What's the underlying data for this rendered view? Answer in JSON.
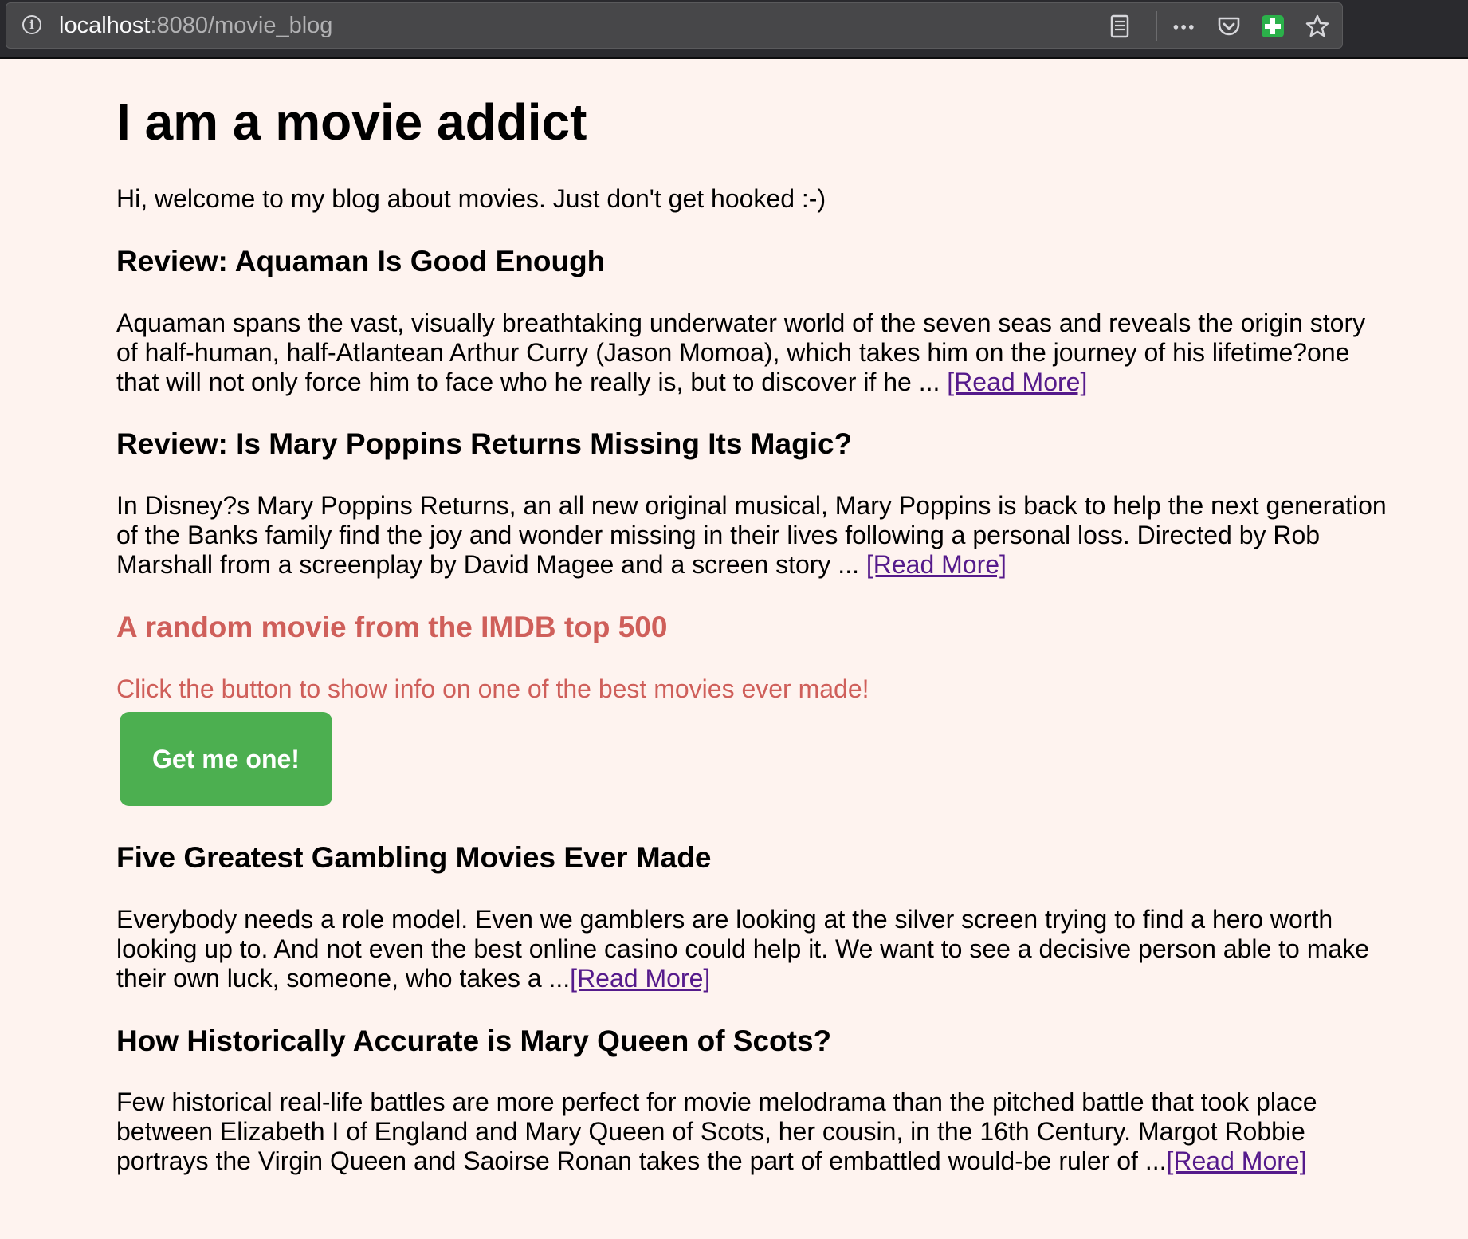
{
  "browser": {
    "url_host": "localhost",
    "url_path": ":8080/movie_blog"
  },
  "page": {
    "title": "I am a movie addict",
    "intro": "Hi, welcome to my blog about movies. Just don't get hooked :-)",
    "read_more": "[Read More]",
    "posts": [
      {
        "title": "Review: Aquaman Is Good Enough",
        "excerpt": "Aquaman spans the vast, visually breathtaking underwater world of the seven seas and reveals the origin story of half-human, half-Atlantean Arthur Curry (Jason Momoa), which takes him on the journey of his lifetime?one that will not only force him to face who he really is, but to discover if he ... "
      },
      {
        "title": "Review: Is Mary Poppins Returns Missing Its Magic?",
        "excerpt": "In Disney?s Mary Poppins Returns, an all new original musical, Mary Poppins is back to help the next generation of the Banks family find the joy and wonder missing in their lives following a personal loss. Directed by Rob Marshall from a screenplay by David Magee and a screen story ... "
      },
      {
        "title": "Five Greatest Gambling Movies Ever Made",
        "excerpt": "Everybody needs a role model. Even we gamblers are looking at the silver screen trying to find a hero worth looking up to. And not even the best online casino could help it. We want to see a decisive person able to make their own luck, someone, who takes a ..."
      },
      {
        "title": "How Historically Accurate is Mary Queen of Scots?",
        "excerpt": "Few historical real-life battles are more perfect for movie melodrama than the pitched battle that took place between Elizabeth I of England and Mary Queen of Scots, her cousin, in the 16th Century. Margot Robbie portrays the Virgin Queen and Saoirse Ronan takes the part of embattled would-be ruler of ..."
      }
    ],
    "imdb": {
      "heading": "A random movie from the IMDB top 500",
      "prompt": "Click the button to show info on one of the best movies ever made!",
      "button_label": "Get me one!"
    }
  },
  "colors": {
    "background": "#fef3ef",
    "accent_red": "#cf5f5a",
    "button_green": "#4caf50",
    "link_visited": "#551a8b"
  },
  "icons": [
    "info-icon",
    "reader-view-icon",
    "more-icon",
    "pocket-icon",
    "extension-plus-icon",
    "bookmark-star-icon"
  ]
}
